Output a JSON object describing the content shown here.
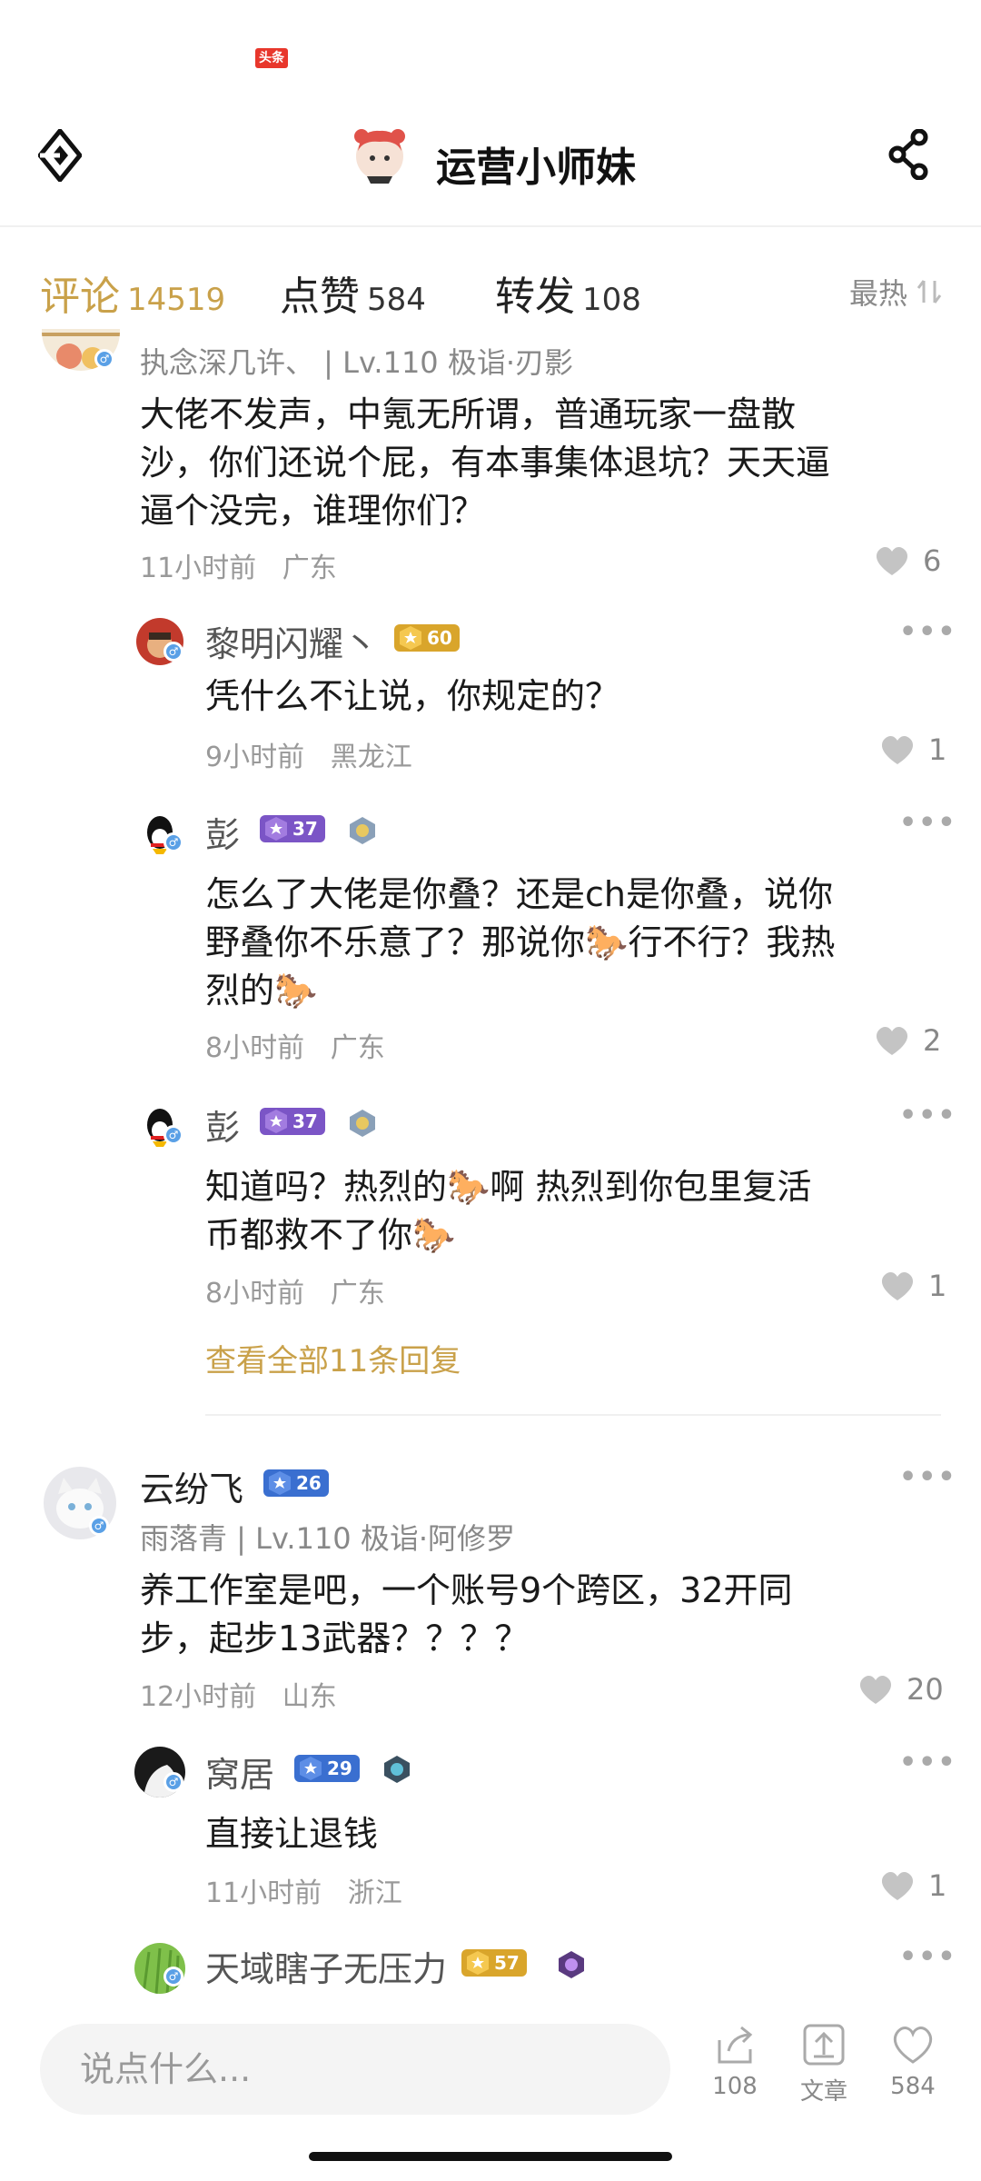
{
  "status_badge": "头条",
  "header": {
    "title": "运营小师妹"
  },
  "tabs": [
    {
      "label": "评论",
      "count": "14519"
    },
    {
      "label": "点赞",
      "count": "584"
    },
    {
      "label": "转发",
      "count": "108"
    }
  ],
  "sort_label": "最热",
  "comments": {
    "c1": {
      "sub": "执念深几许、 | Lv.110 极诣·刃影",
      "text": [
        "大佬不发声，中氪无所谓，普通玩家一盘散",
        "沙，你们还说个屁，有本事集体退坑？天天逼",
        "逼个没完，谁理你们？"
      ],
      "time": "11小时前",
      "location": "广东",
      "likes": "6"
    },
    "r1": {
      "name": "黎明闪耀丶",
      "level": "60",
      "text": "凭什么不让说，你规定的？",
      "time": "9小时前",
      "location": "黑龙江",
      "likes": "1"
    },
    "r2": {
      "name": "彭",
      "level": "37",
      "text": [
        "怎么了大佬是你叠？还是ch是你叠，说你",
        "野叠你不乐意了？那说你🐎行不行？我热",
        "烈的🐎"
      ],
      "time": "8小时前",
      "location": "广东",
      "likes": "2"
    },
    "r3": {
      "name": "彭",
      "level": "37",
      "text": [
        "知道吗？热烈的🐎啊   热烈到你包里复活",
        "币都救不了你🐎"
      ],
      "time": "8小时前",
      "location": "广东",
      "likes": "1"
    },
    "view_all": "查看全部11条回复",
    "c2": {
      "name": "云纷飞",
      "level": "26",
      "sub": "雨落青 | Lv.110 极诣·阿修罗",
      "text": [
        "养工作室是吧，一个账号9个跨区，32开同",
        "步，起步13武器？？？？"
      ],
      "time": "12小时前",
      "location": "山东",
      "likes": "20"
    },
    "r4": {
      "name": "窝居",
      "level": "29",
      "text": "直接让退钱",
      "time": "11小时前",
      "location": "浙江",
      "likes": "1"
    },
    "r5": {
      "name": "天域瞎子无压力",
      "level": "57"
    }
  },
  "bottom": {
    "placeholder": "说点什么...",
    "share_count": "108",
    "article_label": "文章",
    "like_count": "584"
  },
  "colors": {
    "accent": "#c9a14a",
    "gold_badge": "#d9a52b",
    "purple_badge": "#7b55c6",
    "blue_badge": "#3a6fd0"
  }
}
